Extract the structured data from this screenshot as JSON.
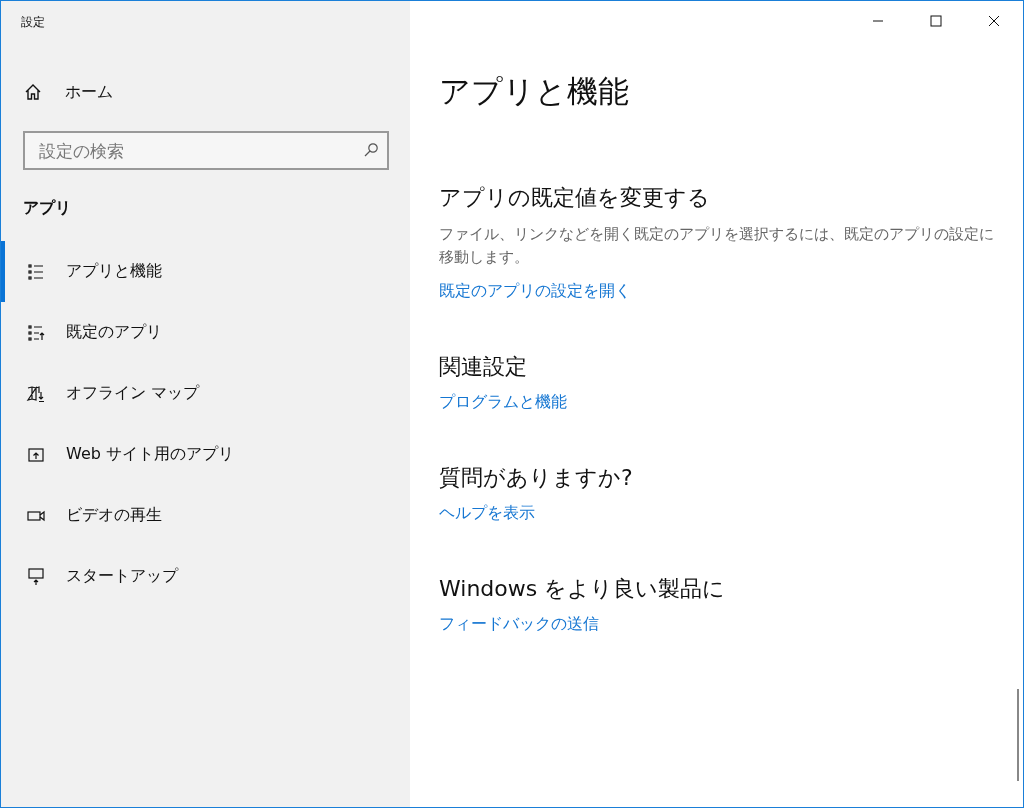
{
  "window": {
    "title": "設定"
  },
  "sidebar": {
    "home": "ホーム",
    "search": {
      "placeholder": "設定の検索"
    },
    "section": "アプリ",
    "items": [
      {
        "label": "アプリと機能",
        "kind": "list",
        "selected": true
      },
      {
        "label": "既定のアプリ",
        "kind": "default",
        "selected": false
      },
      {
        "label": "オフライン マップ",
        "kind": "map",
        "selected": false
      },
      {
        "label": "Web サイト用のアプリ",
        "kind": "web",
        "selected": false
      },
      {
        "label": "ビデオの再生",
        "kind": "video",
        "selected": false
      },
      {
        "label": "スタートアップ",
        "kind": "startup",
        "selected": false
      }
    ]
  },
  "main": {
    "title": "アプリと機能",
    "sections": [
      {
        "heading": "アプリの既定値を変更する",
        "description": "ファイル、リンクなどを開く既定のアプリを選択するには、既定のアプリの設定に移動します。",
        "link": "既定のアプリの設定を開く"
      },
      {
        "heading": "関連設定",
        "link": "プログラムと機能"
      },
      {
        "heading": "質問がありますか?",
        "link": "ヘルプを表示"
      },
      {
        "heading": "Windows をより良い製品に",
        "link": "フィードバックの送信"
      }
    ]
  }
}
